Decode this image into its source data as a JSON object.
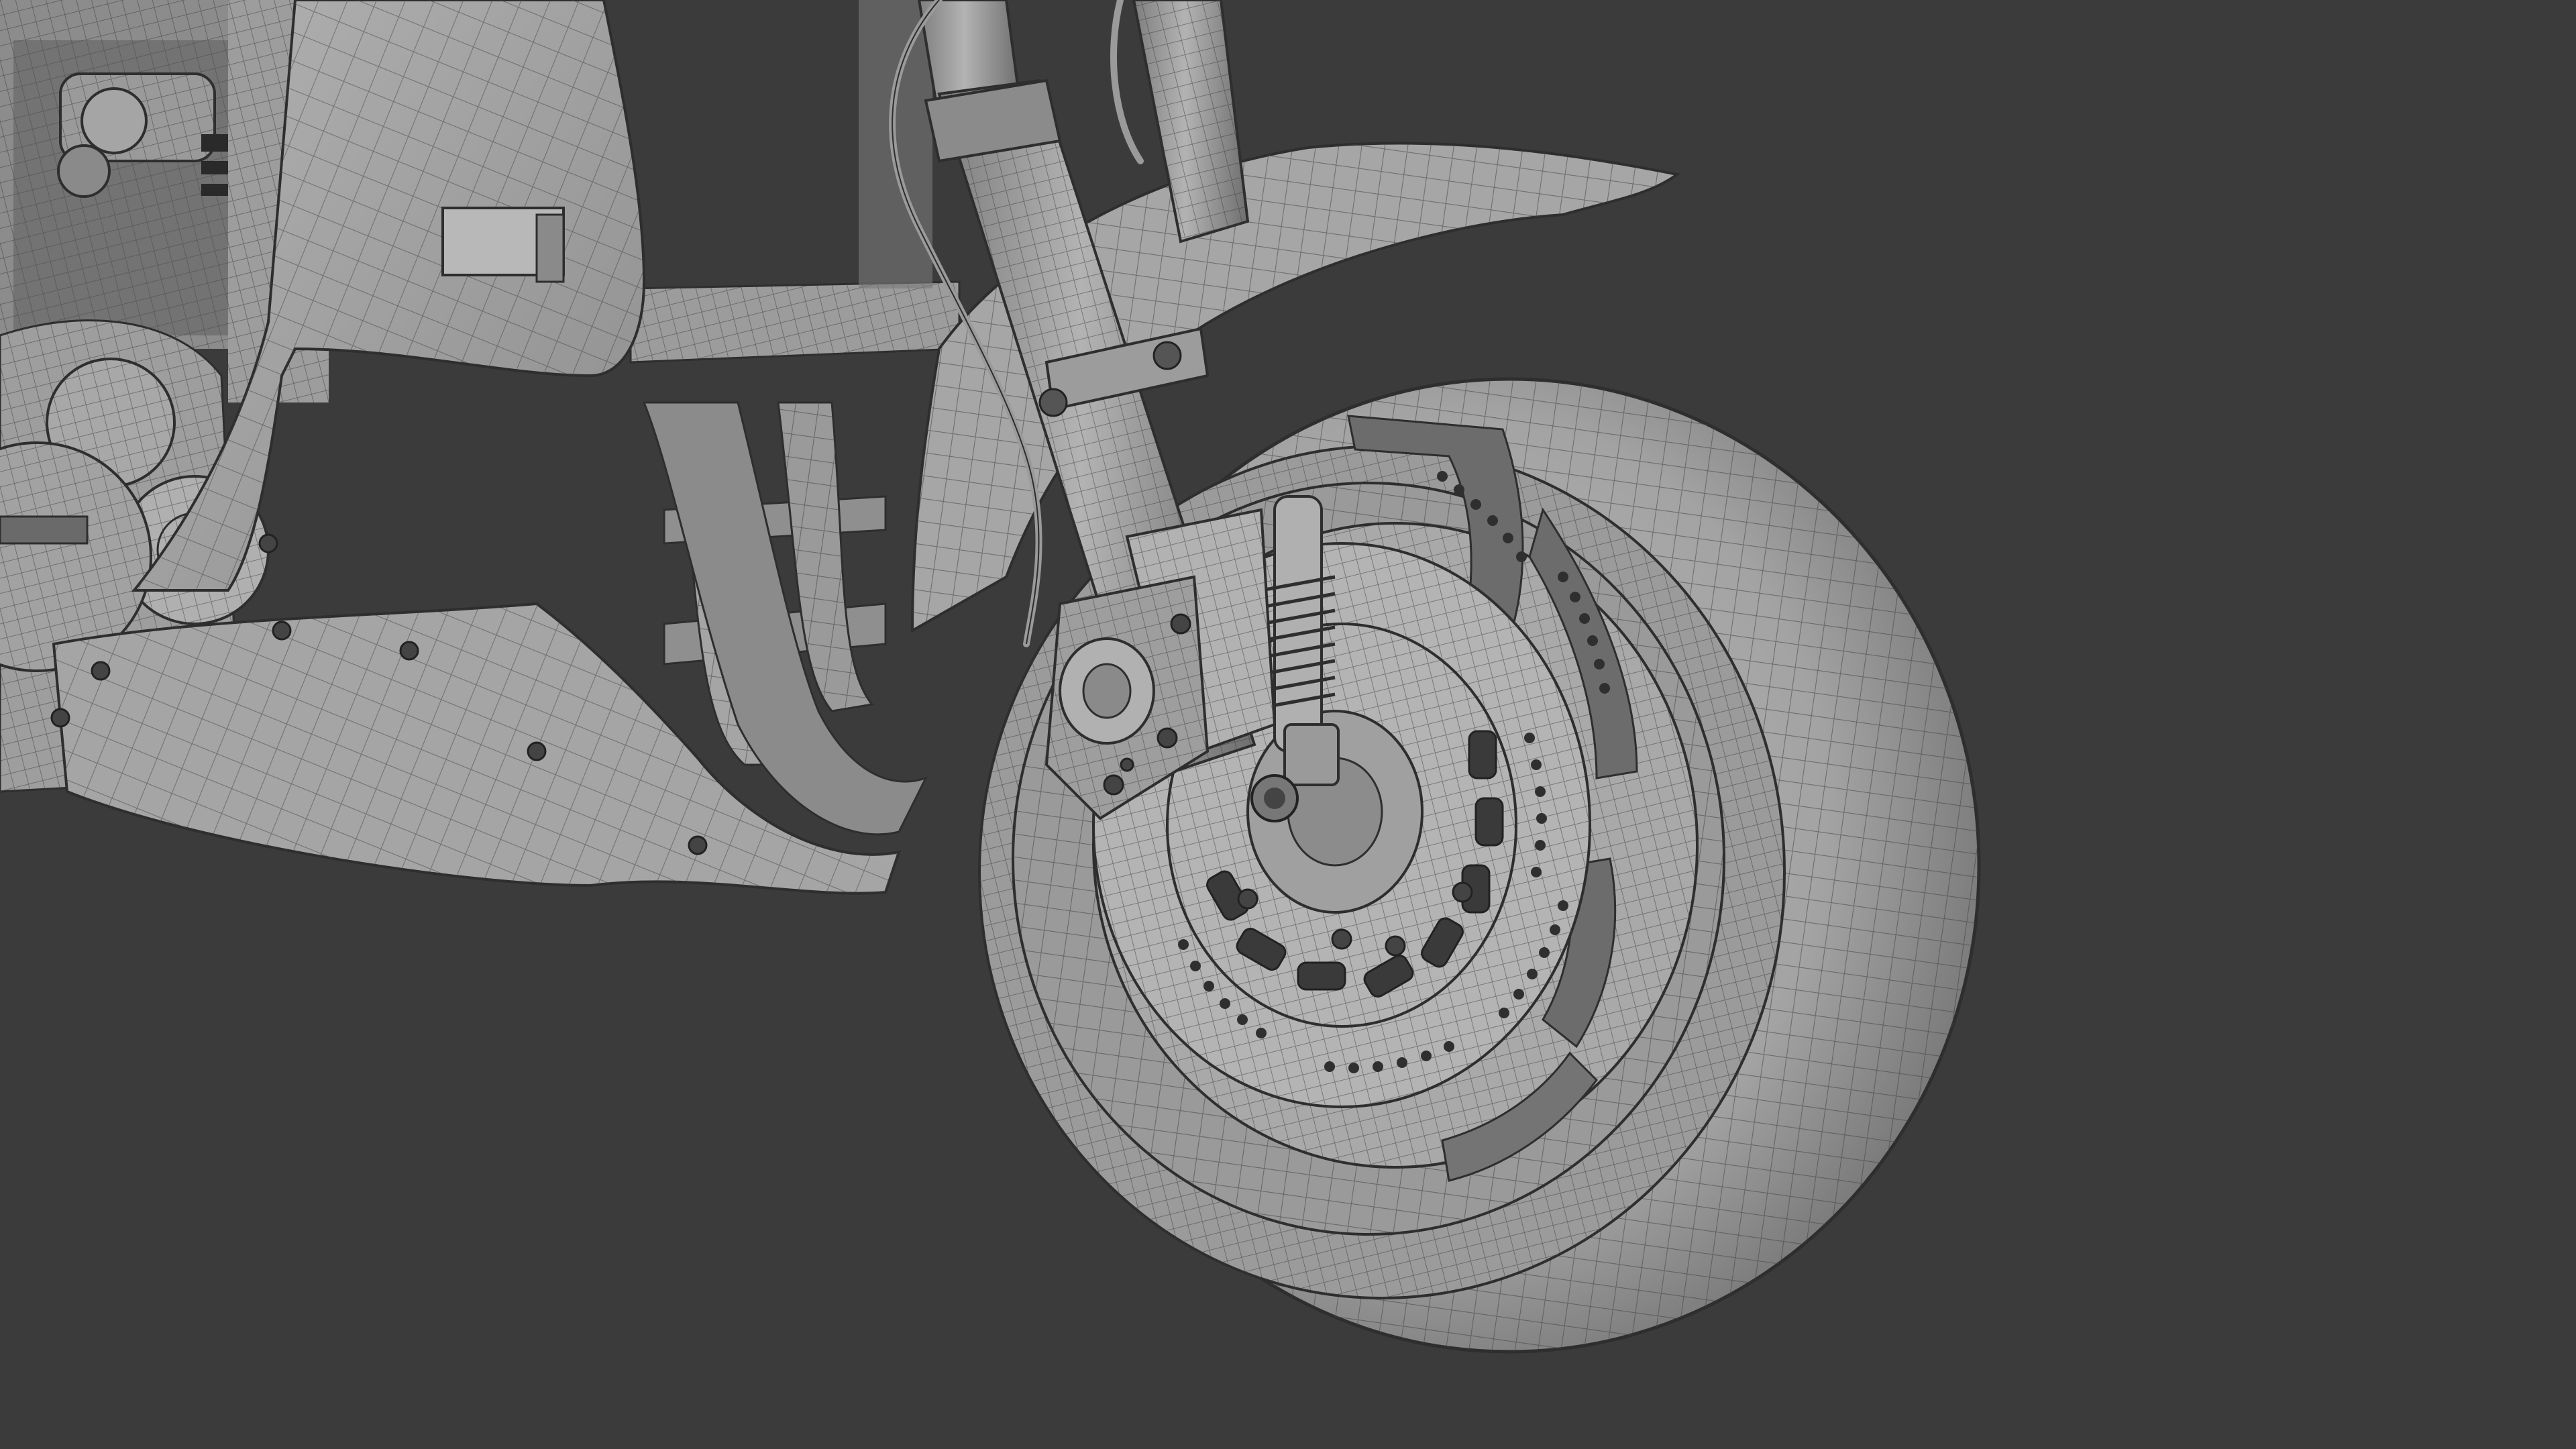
{
  "scene": {
    "subject": "motorcycle-front-wheel-wireframe",
    "background_color": "#3b3b3b",
    "surface_color": "#a2a2a2",
    "surface_shadow_color": "#6e6e6e",
    "wire_color": "#3f3f3f",
    "dark_color": "#2a2a2a"
  }
}
